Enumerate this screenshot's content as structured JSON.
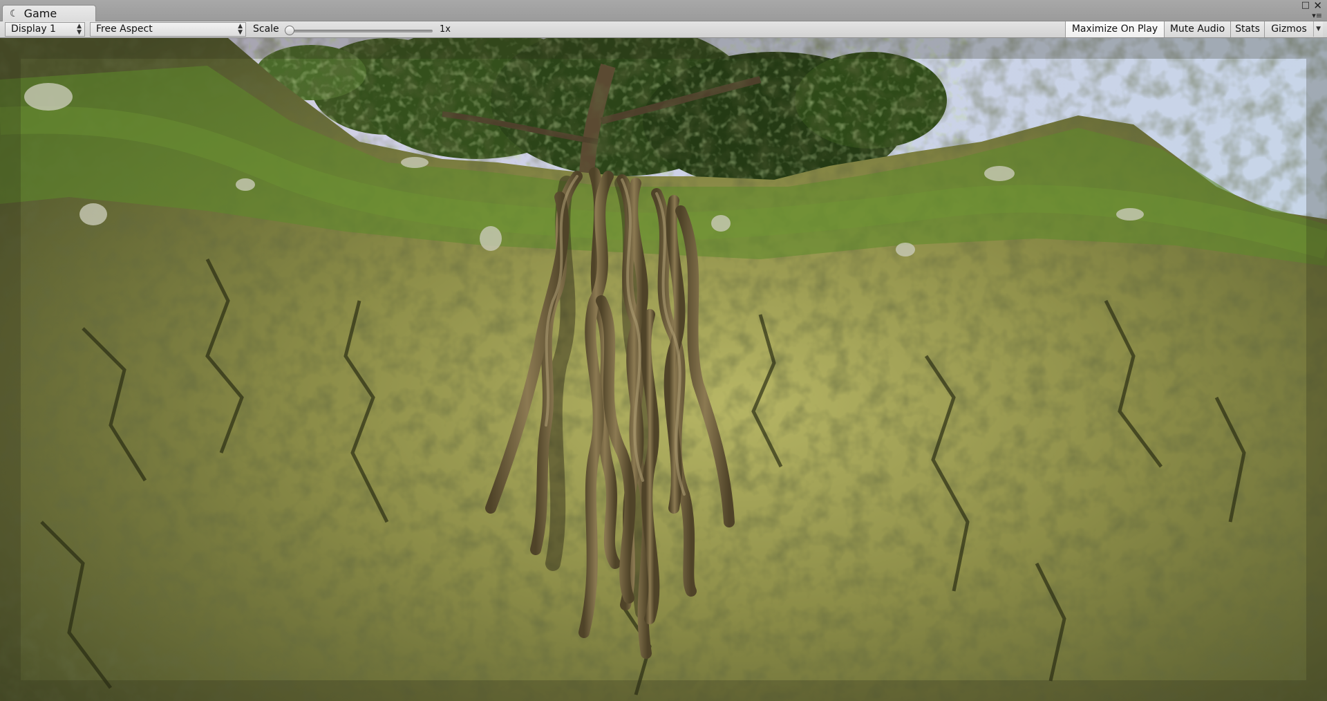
{
  "window": {
    "tab_title": "Game",
    "tab_icon": "unity-game-icon"
  },
  "toolbar": {
    "display": "Display 1",
    "aspect": "Free Aspect",
    "scale_label": "Scale",
    "scale_value": "1x",
    "scale_level": 0,
    "buttons": {
      "maximize_on_play": "Maximize On Play",
      "mute_audio": "Mute Audio",
      "stats": "Stats",
      "gizmos": "Gizmos"
    },
    "maximize_on_play_active": true
  },
  "scene": {
    "sky_color": "#cfd6e6",
    "cliff_color": "#7d8440",
    "moss_color": "#5f8a2a",
    "root_color": "#7d6a45",
    "foliage_color": "#2f4a1a"
  }
}
